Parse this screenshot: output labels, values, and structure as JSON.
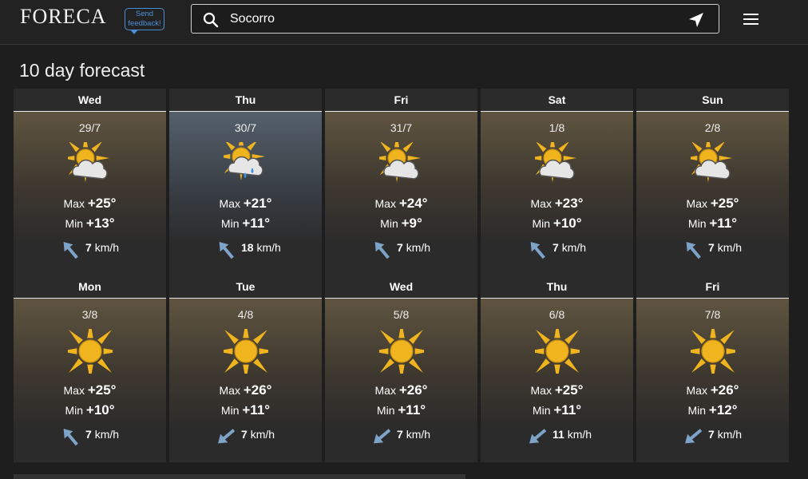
{
  "header": {
    "logo": "FORECA",
    "feedback_label_1": "Send",
    "feedback_label_2": "feedback!",
    "search_value": "Socorro",
    "icons": [
      "search-icon",
      "location-arrow-icon",
      "hamburger-menu-icon"
    ]
  },
  "page_title": "10 day forecast",
  "labels": {
    "max": "Max",
    "min": "Min",
    "wind_unit": "km/h"
  },
  "colors": {
    "sun": "#f0b41e",
    "rain_drop": "#3a8fe0",
    "wind_arrow": "#7da3c8",
    "feedback": "#4a90d9"
  },
  "days": [
    {
      "day": "Wed",
      "date": "29/7",
      "icon": "partly-cloudy-icon",
      "max": "+25°",
      "min": "+13°",
      "wind": "7",
      "wind_dir": "nw"
    },
    {
      "day": "Thu",
      "date": "30/7",
      "icon": "partly-cloudy-rain-icon",
      "max": "+21°",
      "min": "+11°",
      "wind": "18",
      "wind_dir": "nw"
    },
    {
      "day": "Fri",
      "date": "31/7",
      "icon": "partly-cloudy-icon",
      "max": "+24°",
      "min": "+9°",
      "wind": "7",
      "wind_dir": "nw"
    },
    {
      "day": "Sat",
      "date": "1/8",
      "icon": "partly-cloudy-icon",
      "max": "+23°",
      "min": "+10°",
      "wind": "7",
      "wind_dir": "nw"
    },
    {
      "day": "Sun",
      "date": "2/8",
      "icon": "partly-cloudy-icon",
      "max": "+25°",
      "min": "+11°",
      "wind": "7",
      "wind_dir": "nw"
    },
    {
      "day": "Mon",
      "date": "3/8",
      "icon": "sun-icon",
      "max": "+25°",
      "min": "+10°",
      "wind": "7",
      "wind_dir": "nw"
    },
    {
      "day": "Tue",
      "date": "4/8",
      "icon": "sun-icon",
      "max": "+26°",
      "min": "+11°",
      "wind": "7",
      "wind_dir": "sw"
    },
    {
      "day": "Wed",
      "date": "5/8",
      "icon": "sun-icon",
      "max": "+26°",
      "min": "+11°",
      "wind": "7",
      "wind_dir": "sw"
    },
    {
      "day": "Thu",
      "date": "6/8",
      "icon": "sun-icon",
      "max": "+25°",
      "min": "+11°",
      "wind": "11",
      "wind_dir": "sw"
    },
    {
      "day": "Fri",
      "date": "7/8",
      "icon": "sun-icon",
      "max": "+26°",
      "min": "+12°",
      "wind": "7",
      "wind_dir": "sw"
    }
  ]
}
